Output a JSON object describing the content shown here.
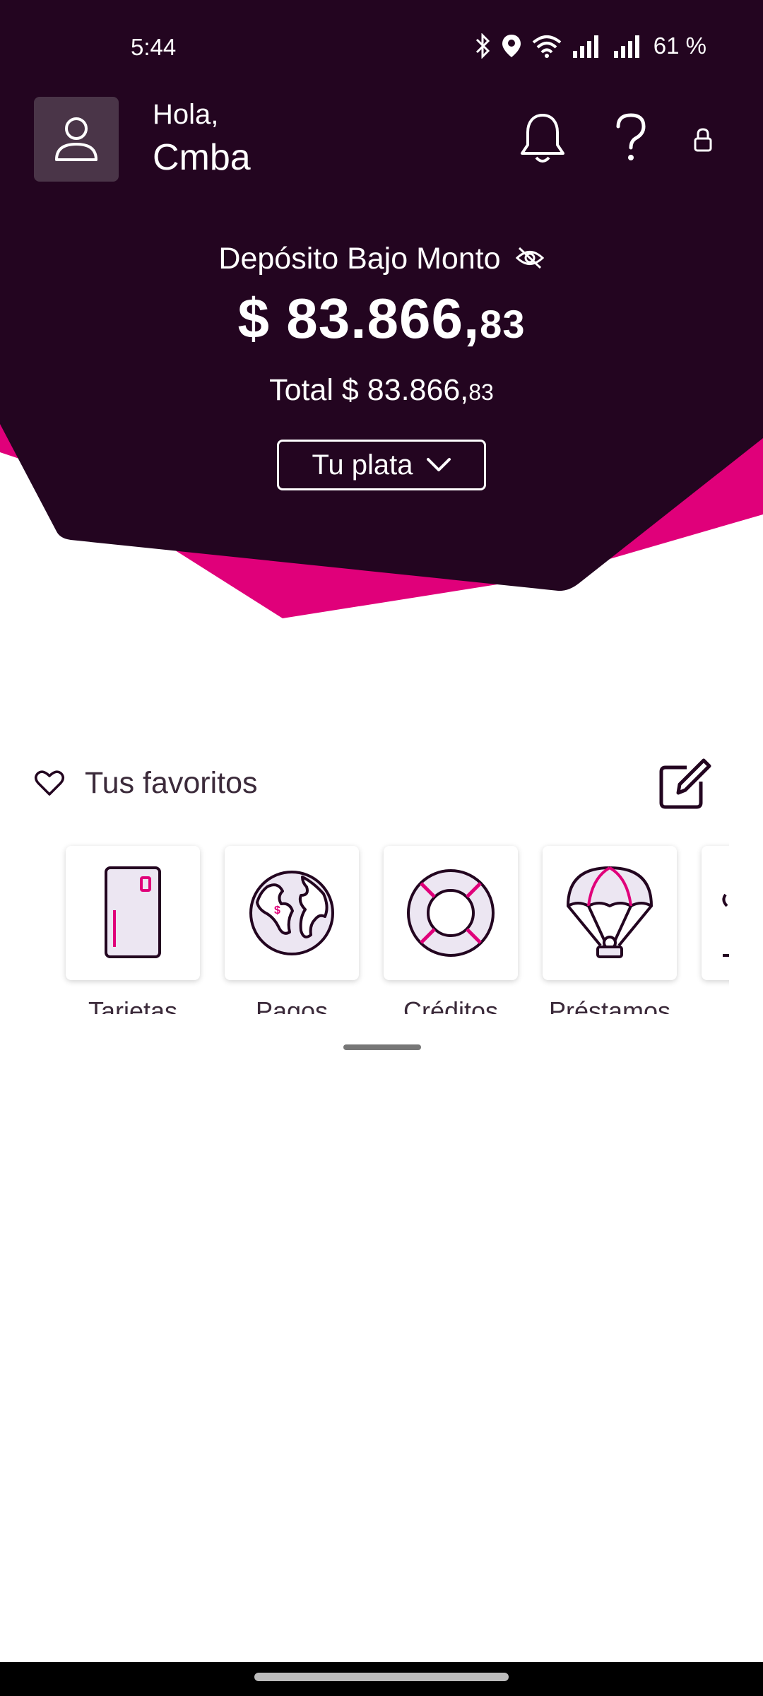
{
  "status_bar": {
    "time": "5:44",
    "battery": "61 %"
  },
  "header": {
    "greeting": "Hola,",
    "user_name": "Cmba"
  },
  "account": {
    "label": "Depósito Bajo Monto",
    "amount_main": "$ 83.866,",
    "amount_cents": "83",
    "total_main": "Total $ 83.866,",
    "total_cents": "83",
    "selector_label": "Tu plata"
  },
  "favorites": {
    "title": "Tus favoritos",
    "items": [
      {
        "label": "Tarjetas",
        "icon": "card-icon"
      },
      {
        "label": "Pagos",
        "icon": "globe-icon"
      },
      {
        "label": "Créditos",
        "icon": "lifebuoy-icon"
      },
      {
        "label": "Préstamos",
        "icon": "parachute-icon"
      }
    ]
  },
  "colors": {
    "header_bg": "#230520",
    "accent": "#e0007a"
  }
}
